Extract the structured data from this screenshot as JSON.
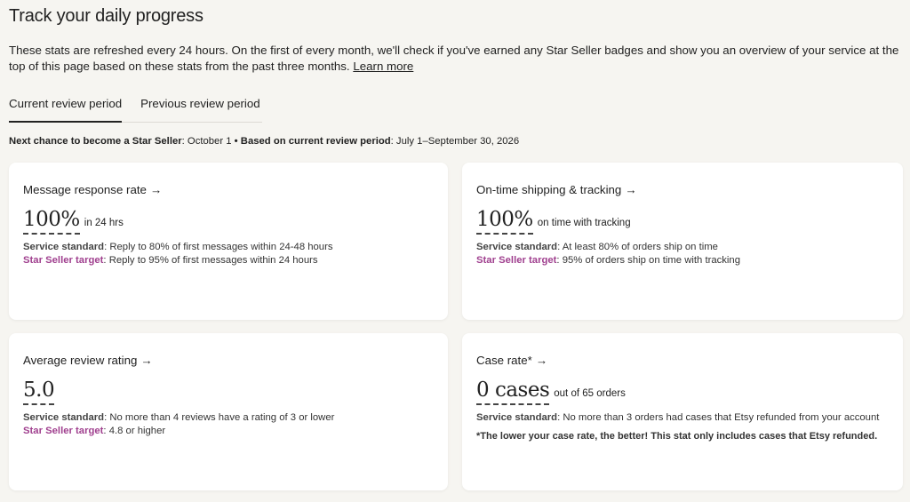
{
  "header": {
    "title": "Track your daily progress",
    "intro": "These stats are refreshed every 24 hours. On the first of every month, we'll check if you've earned any Star Seller badges and show you an overview of your service at the top of this page based on these stats from the past three months.",
    "learn_more": "Learn more"
  },
  "tabs": [
    {
      "label": "Current review period",
      "active": true
    },
    {
      "label": "Previous review period",
      "active": false
    }
  ],
  "period": {
    "next_label": "Next chance to become a Star Seller",
    "next_value": ": October 1 ",
    "bullet": "•",
    "based_label": " Based on current review period",
    "based_value": ": July 1–September 30, 2026"
  },
  "labels": {
    "service_standard": "Service standard",
    "star_target": "Star Seller target",
    "arrow": "→"
  },
  "cards": {
    "message": {
      "title": "Message response rate",
      "value": "100%",
      "suffix": "in 24 hrs",
      "standard": ": Reply to 80% of first messages within 24-48 hours",
      "target": ": Reply to 95% of first messages within 24 hours"
    },
    "shipping": {
      "title": "On-time shipping & tracking",
      "value": "100%",
      "suffix": "on time with tracking",
      "standard": ": At least 80% of orders ship on time",
      "target": ": 95% of orders ship on time with tracking"
    },
    "review": {
      "title": "Average review rating",
      "value": "5.0",
      "standard": ": No more than 4 reviews have a rating of 3 or lower",
      "target": ": 4.8 or higher"
    },
    "case": {
      "title": "Case rate*",
      "value": "0 cases",
      "suffix": "out of 65 orders",
      "standard": ": No more than 3 orders had cases that Etsy refunded from your account",
      "footnote": "*The lower your case rate, the better! This stat only includes cases that Etsy refunded."
    }
  }
}
